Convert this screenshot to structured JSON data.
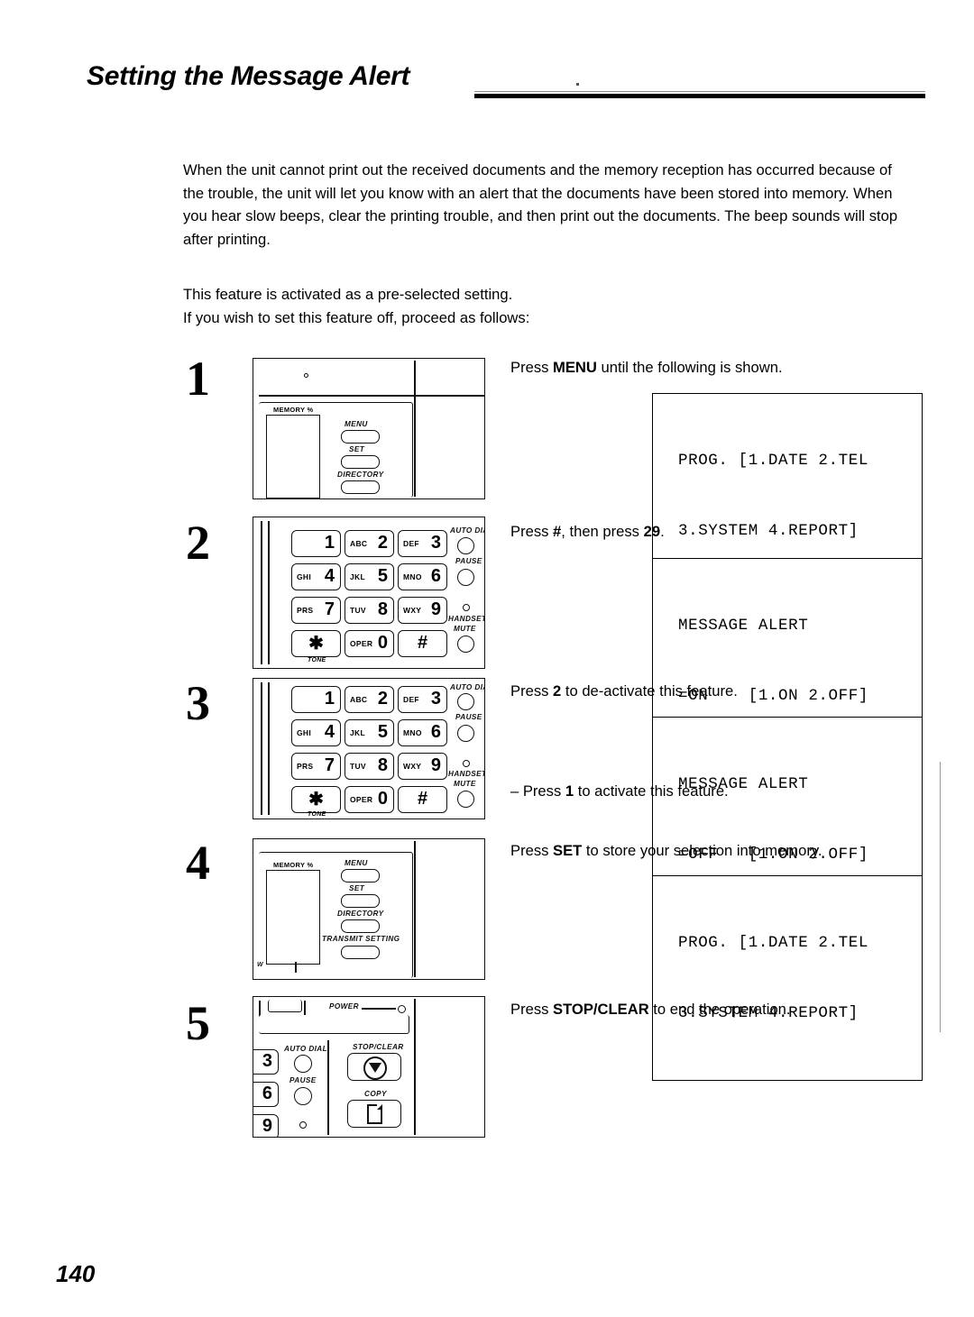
{
  "header": {
    "title": "Setting the Message Alert"
  },
  "intro": {
    "paragraph1": "When the unit cannot print out the received documents and the memory reception has occurred because of the trouble, the unit will let you know with an alert that the documents have been stored into memory. When you hear slow beeps, clear the printing trouble, and then print out the documents. The beep sounds will stop after printing.",
    "paragraph2_line1": "This feature is activated as a pre-selected setting.",
    "paragraph2_line2": "If you wish to set this feature off, proceed as follows:"
  },
  "steps": [
    {
      "number": "1",
      "instruction_pre": "Press ",
      "instruction_bold": "MENU",
      "instruction_post": " until the following is shown.",
      "lcd_line1": "PROG. [1.DATE 2.TEL",
      "lcd_line2": "3.SYSTEM 4.REPORT]",
      "illustration": "control-panel-menu-set-directory"
    },
    {
      "number": "2",
      "instruction_pre": "Press ",
      "instruction_bold": "#",
      "instruction_mid": ", then press ",
      "instruction_bold2": "29",
      "instruction_post": ".",
      "lcd_line1": "MESSAGE ALERT",
      "lcd_line2": "=ON    [1.ON 2.OFF]",
      "illustration": "numeric-keypad"
    },
    {
      "number": "3",
      "instruction_pre": "Press ",
      "instruction_bold": "2",
      "instruction_post": " to de-activate this feature.",
      "lcd_line1": "MESSAGE ALERT",
      "lcd_line2": "=OFF   [1.ON 2.OFF]",
      "subnote_pre": "– Press ",
      "subnote_bold": "1",
      "subnote_post": " to activate this feature.",
      "illustration": "numeric-keypad"
    },
    {
      "number": "4",
      "instruction_pre": "Press ",
      "instruction_bold": "SET",
      "instruction_post": " to store your selection into memory.",
      "lcd_line1": "PROG. [1.DATE 2.TEL",
      "lcd_line2": "3.SYSTEM 4.REPORT]",
      "illustration": "control-panel-with-transmit-setting"
    },
    {
      "number": "5",
      "instruction_pre": "Press ",
      "instruction_bold": "STOP/CLEAR",
      "instruction_post": " to end the operation.",
      "illustration": "power-stop-copy-panel"
    }
  ],
  "panel_labels": {
    "menu": "MENU",
    "set": "SET",
    "directory": "DIRECTORY",
    "transmit_setting": "TRANSMIT SETTING",
    "memory_percent": "MEMORY %",
    "auto_dial": "AUTO DIAL",
    "pause": "PAUSE",
    "handset": "HANDSET",
    "mute": "MUTE",
    "tone": "TONE",
    "power": "POWER",
    "stop_clear": "STOP/CLEAR",
    "copy": "COPY"
  },
  "keypad": {
    "keys": [
      {
        "digit": "1",
        "alpha": ""
      },
      {
        "digit": "2",
        "alpha": "ABC"
      },
      {
        "digit": "3",
        "alpha": "DEF"
      },
      {
        "digit": "4",
        "alpha": "GHI"
      },
      {
        "digit": "5",
        "alpha": "JKL"
      },
      {
        "digit": "6",
        "alpha": "MNO"
      },
      {
        "digit": "7",
        "alpha": "PRS"
      },
      {
        "digit": "8",
        "alpha": "TUV"
      },
      {
        "digit": "9",
        "alpha": "WXY"
      },
      {
        "digit": "✱",
        "alpha": ""
      },
      {
        "digit": "0",
        "alpha": "OPER"
      },
      {
        "digit": "#",
        "alpha": ""
      }
    ],
    "partial_keys_step5": [
      "3",
      "6",
      "9"
    ]
  },
  "footer": {
    "page_number": "140"
  }
}
